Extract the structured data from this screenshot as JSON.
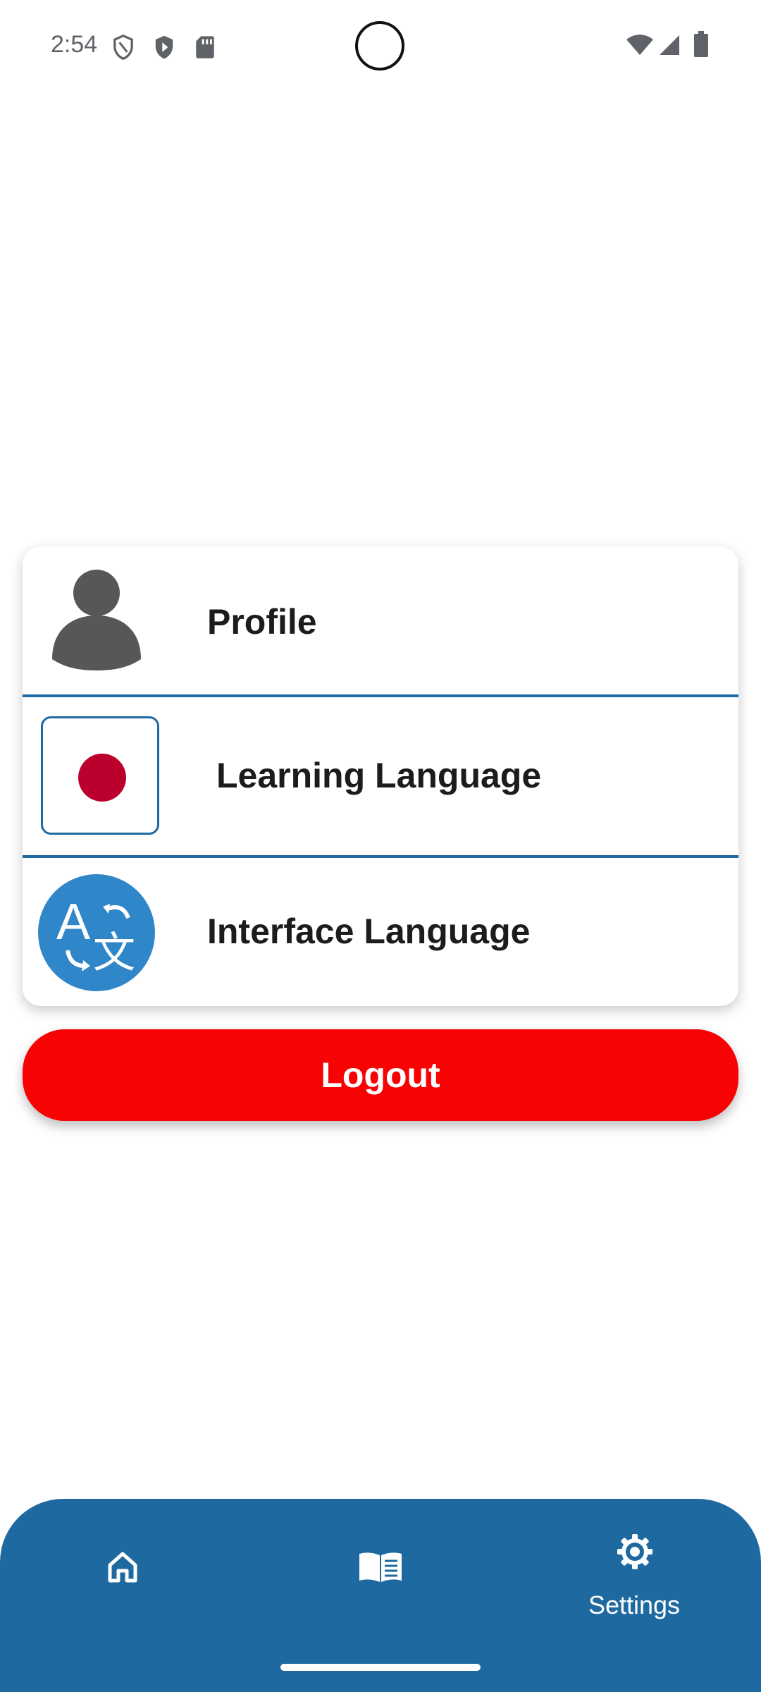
{
  "status_bar": {
    "time": "2:54",
    "left_icons": [
      "shield-outline-icon",
      "play-shield-icon",
      "sd-card-icon"
    ],
    "right_icons": [
      "wifi-icon",
      "cell-signal-icon",
      "battery-icon"
    ]
  },
  "settings": {
    "items": [
      {
        "label": "Profile",
        "icon": "person-icon"
      },
      {
        "label": "Learning Language",
        "icon": "japan-flag-icon"
      },
      {
        "label": "Interface Language",
        "icon": "translate-icon"
      }
    ]
  },
  "logout": {
    "label": "Logout",
    "color": "#f70303"
  },
  "bottom_nav": {
    "items": [
      {
        "label": "",
        "icon": "home-icon"
      },
      {
        "label": "",
        "icon": "book-icon"
      },
      {
        "label": "Settings",
        "icon": "gear-icon",
        "active": true
      }
    ]
  },
  "colors": {
    "accent": "#1f69a1",
    "flag_red": "#bc002d",
    "translate_blue": "#2f86c8"
  }
}
